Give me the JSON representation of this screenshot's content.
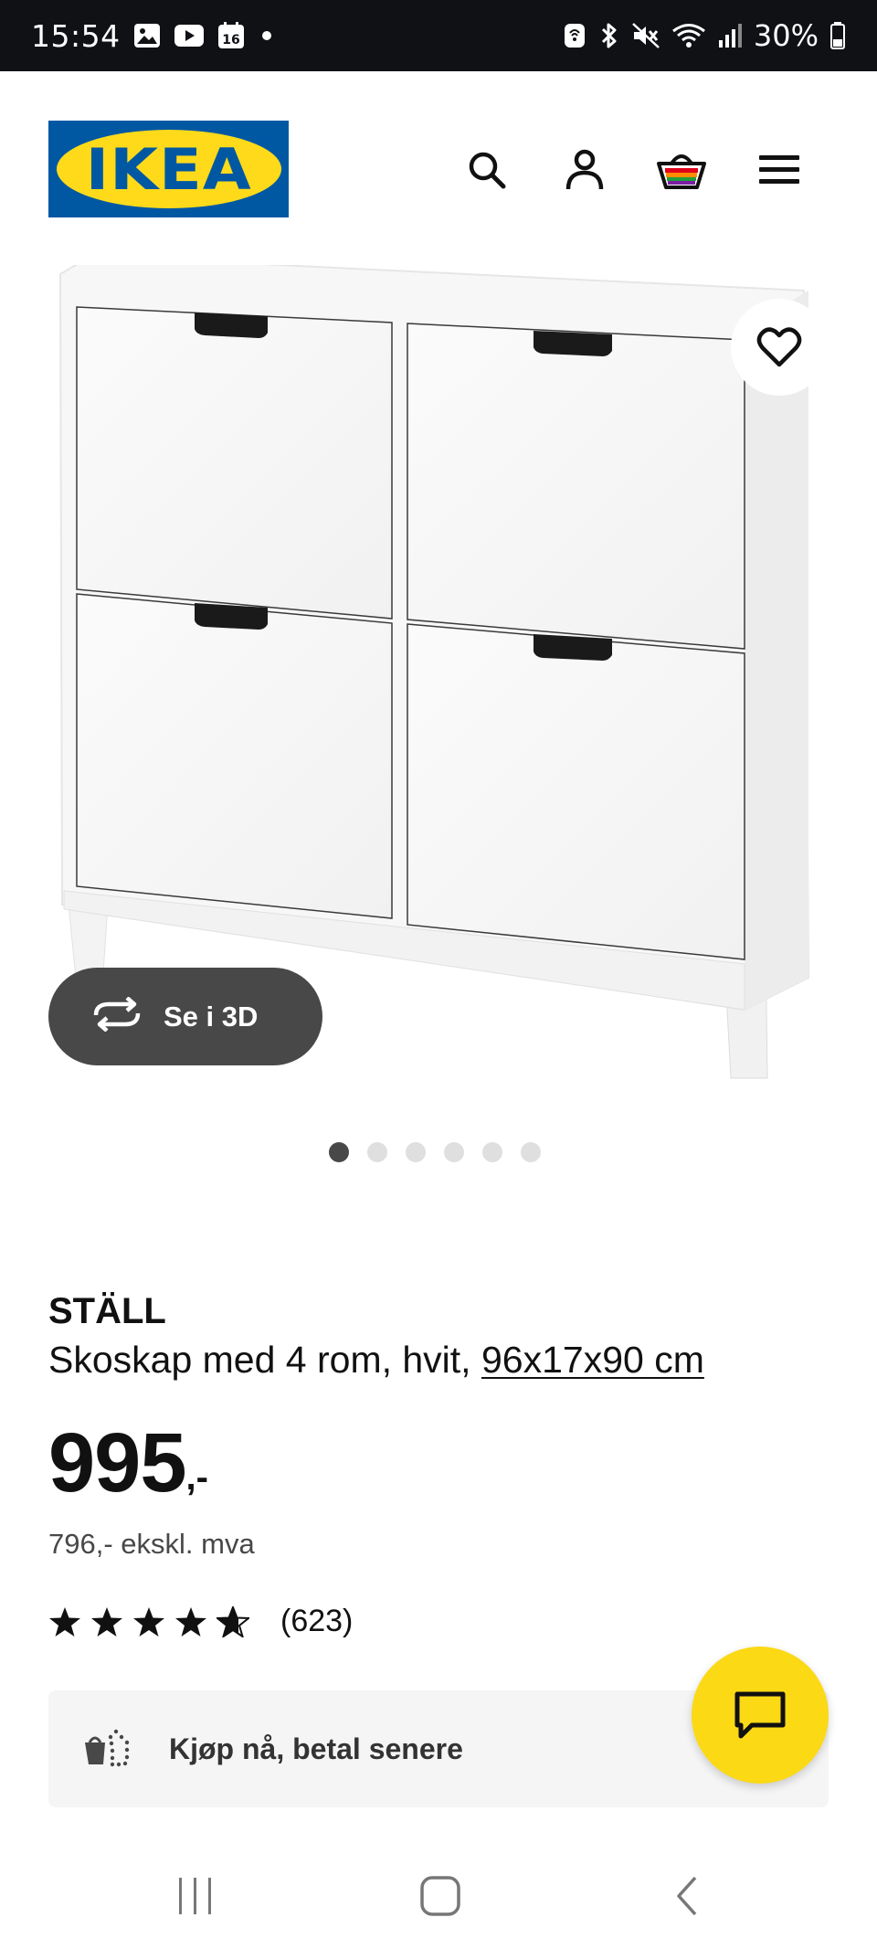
{
  "status_bar": {
    "time": "15:54",
    "calendar_day": "16",
    "battery": "30%",
    "icons": [
      "gallery-icon",
      "youtube-icon",
      "calendar-icon",
      "notification-dot-icon",
      "nfc-icon",
      "bluetooth-icon",
      "mute-icon",
      "wifi-icon",
      "signal-icon",
      "battery-icon"
    ]
  },
  "header": {
    "logo_text": "IKEA",
    "icons": [
      "search-icon",
      "account-icon",
      "cart-icon",
      "menu-icon"
    ]
  },
  "product_image": {
    "view3d_label": "Se i 3D",
    "pages": 6,
    "active_page": 1
  },
  "product": {
    "name": "STÄLL",
    "description": "Skoskap med 4 rom, hvit,",
    "dimensions": "96x17x90 cm",
    "price": "995",
    "price_suffix": ",-",
    "price_ex_vat": "796,- ekskl. mva",
    "rating_stars": 4.5,
    "rating_count": "(623)"
  },
  "paylater": {
    "label": "Kjøp nå, betal senere"
  },
  "colors": {
    "ikea_blue": "#0058a3",
    "ikea_yellow": "#ffda1a",
    "chat_yellow": "#fbd914",
    "dark_grey": "#484848"
  }
}
